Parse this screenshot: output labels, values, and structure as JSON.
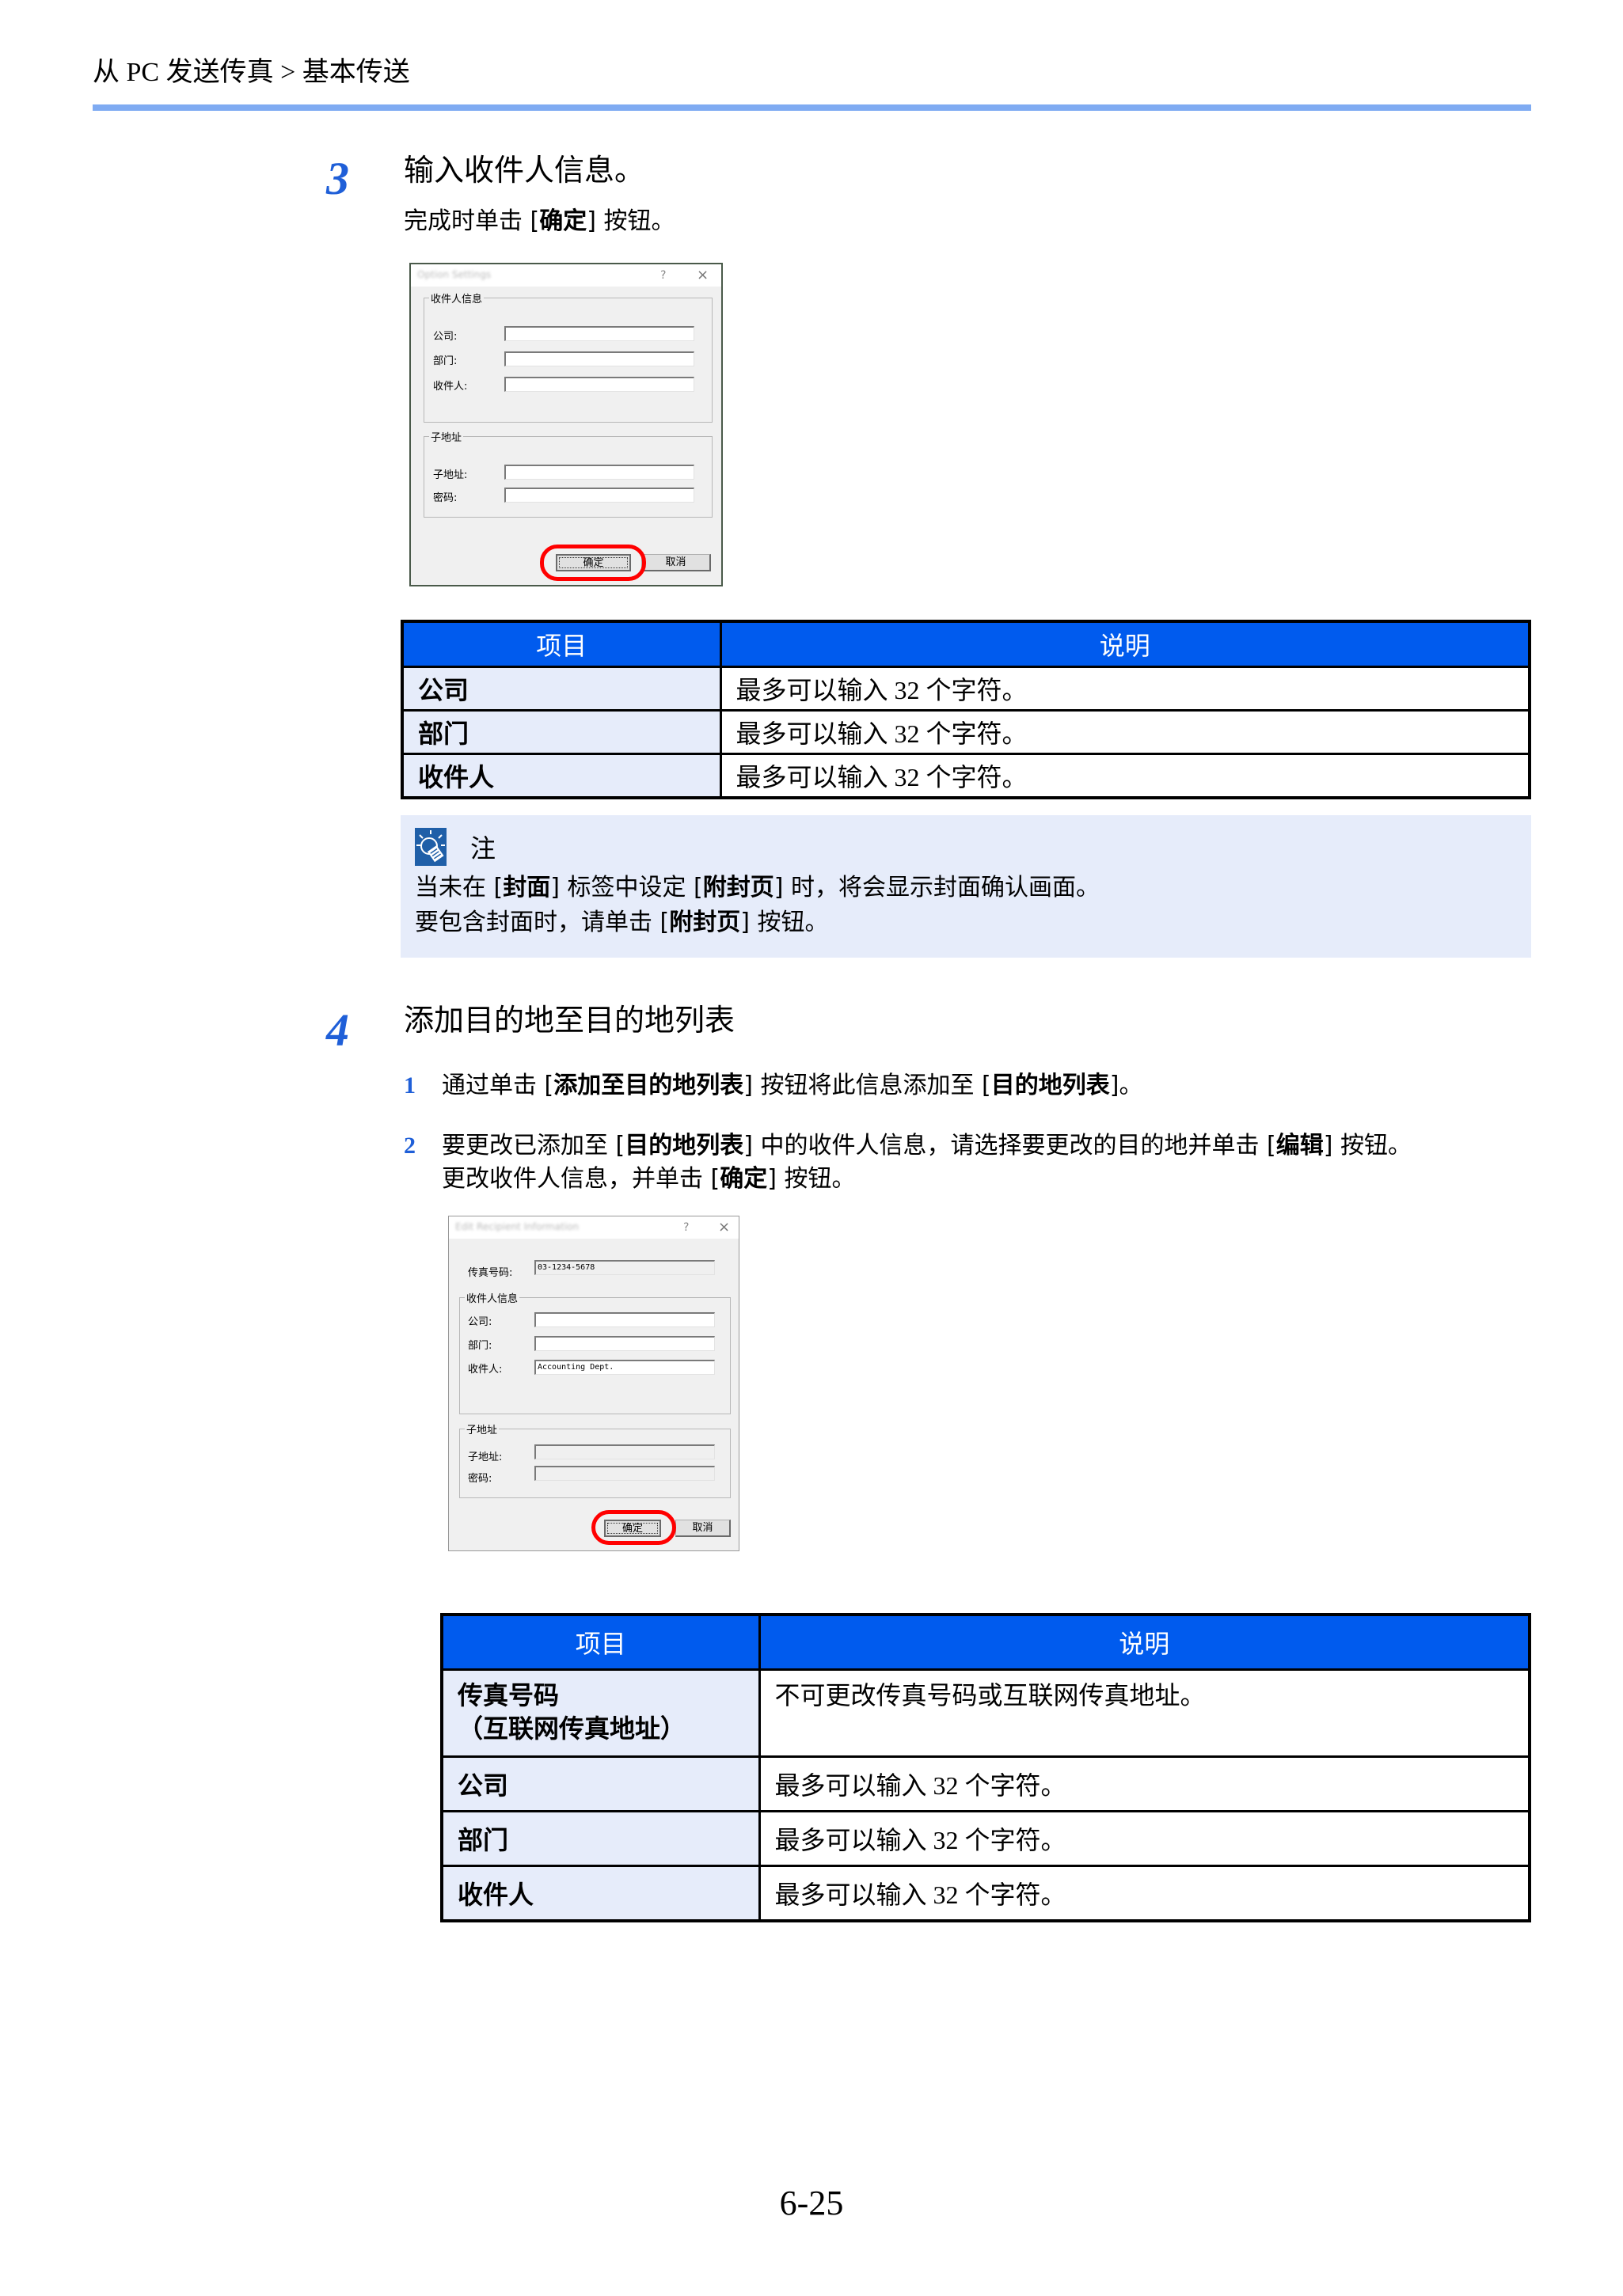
{
  "header": {
    "breadcrumb": "从 PC 发送传真 > 基本传送"
  },
  "colors": {
    "accent_blue": "#005bee",
    "rule_blue": "#7fabf2",
    "step_blue": "#1f5fd8",
    "row_item_bg": "#e6ecfa",
    "highlight_red": "#ff0000"
  },
  "step3": {
    "number": "3",
    "title": "输入收件人信息。",
    "instruction_prefix": "完成时单击 [",
    "instruction_bold": "确定",
    "instruction_suffix": "] 按钮。",
    "dialog": {
      "title": "Option Settings",
      "help_icon": "?",
      "close_icon": "×",
      "group_recipient": "收件人信息",
      "company_label": "公司:",
      "company_value": "",
      "department_label": "部门:",
      "department_value": "",
      "recipient_label": "收件人:",
      "recipient_value": "",
      "group_subaddress": "子地址",
      "subaddress_label": "子地址:",
      "subaddress_value": "",
      "password_label": "密码:",
      "password_value": "",
      "ok_label": "确定",
      "cancel_label": "取消"
    },
    "table": {
      "headers": [
        "项目",
        "说明"
      ],
      "rows": [
        {
          "item": "公司",
          "desc": "最多可以输入 32 个字符。"
        },
        {
          "item": "部门",
          "desc": "最多可以输入 32 个字符。"
        },
        {
          "item": "收件人",
          "desc": "最多可以输入 32 个字符。"
        }
      ]
    },
    "note": {
      "icon": "lightbulb-icon",
      "title": "注",
      "line1_a": "当未在 [",
      "line1_b": "封面",
      "line1_c": "] 标签中设定 [",
      "line1_d": "附封页",
      "line1_e": "] 时，将会显示封面确认画面。",
      "line2_a": "要包含封面时，请单击 [",
      "line2_b": "附封页",
      "line2_c": "] 按钮。"
    }
  },
  "step4": {
    "number": "4",
    "title": "添加目的地至目的地列表",
    "substeps": [
      {
        "number": "1",
        "a": "通过单击 [",
        "b": "添加至目的地列表",
        "c": "] 按钮将此信息添加至 [",
        "d": "目的地列表",
        "e": "]。"
      },
      {
        "number": "2",
        "a": "要更改已添加至 [",
        "b": "目的地列表",
        "c": "] 中的收件人信息，请选择要更改的目的地并单击 [",
        "d": "编辑",
        "e": "] 按钮。",
        "line2_a": "更改收件人信息，并单击 [",
        "line2_b": "确定",
        "line2_c": "] 按钮。"
      }
    ],
    "dialog": {
      "title": "Edit Recipient Information",
      "help_icon": "?",
      "close_icon": "×",
      "fax_label": "传真号码:",
      "fax_value": "03-1234-5678",
      "group_recipient": "收件人信息",
      "company_label": "公司:",
      "company_value": "",
      "department_label": "部门:",
      "department_value": "",
      "recipient_label": "收件人:",
      "recipient_value": "Accounting Dept.",
      "group_subaddress": "子地址",
      "subaddress_label": "子地址:",
      "subaddress_value": "",
      "password_label": "密码:",
      "password_value": "",
      "ok_label": "确定",
      "cancel_label": "取消"
    },
    "table": {
      "headers": [
        "项目",
        "说明"
      ],
      "rows": [
        {
          "item": "传真号码",
          "item_line2": "（互联网传真地址）",
          "desc": "不可更改传真号码或互联网传真地址。"
        },
        {
          "item": "公司",
          "desc": "最多可以输入 32 个字符。"
        },
        {
          "item": "部门",
          "desc": "最多可以输入 32 个字符。"
        },
        {
          "item": "收件人",
          "desc": "最多可以输入 32 个字符。"
        }
      ]
    }
  },
  "footer": {
    "page_number": "6-25"
  }
}
